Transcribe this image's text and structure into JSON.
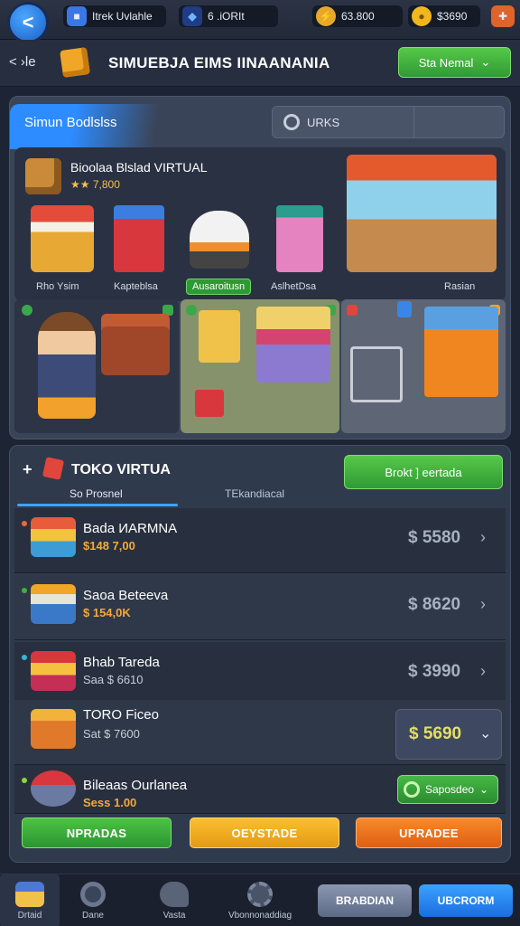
{
  "colors": {
    "accent_blue": "#2d8cff",
    "accent_green": "#3fb13d",
    "accent_orange": "#f0861f",
    "accent_yellow": "#f4b52a",
    "price_highlight": "#e4e060"
  },
  "topbar": {
    "back_label": "<",
    "stat_1": {
      "icon": "game-controller-icon",
      "value": "Itrek Uvlahle"
    },
    "stat_2": {
      "icon": "gem-icon",
      "value": "6 .iORIt"
    },
    "stat_3": {
      "icon": "coin-icon",
      "value": "63.800"
    },
    "stat_4": {
      "icon": "gold-coin-icon",
      "value": "$3690"
    },
    "settings_icon": "tool-icon"
  },
  "header": {
    "back": "< ›le",
    "title": "SIMUEBJA EIMS IINAANANIA",
    "mode_button": "Sta Nemal",
    "mode_chevron": "⌄"
  },
  "panel": {
    "tag": "Simun Bodlslss",
    "search_placeholder": "URKS"
  },
  "business": {
    "title": "Bioolaa Blslad VIRTUAL",
    "stars": "★★",
    "rating_value": "7,800",
    "items": [
      {
        "label": "Rho Ysim"
      },
      {
        "label": "Kapteblsa"
      },
      {
        "label": "Ausaroitusn"
      },
      {
        "label": "AslhetDsa"
      },
      {
        "label": "Rasian"
      }
    ],
    "selected_index": 2
  },
  "section": {
    "plus": "+",
    "name": "TOKO VIRTUA",
    "cta": "Brokt ] eertada",
    "tab_1": "So Prosnel",
    "tab_2": "TEkandiacal"
  },
  "rows": [
    {
      "name": "Bada ИARMNA",
      "sub": "$148 7,00",
      "price": "$ 5580",
      "chev": "›"
    },
    {
      "name": "Saoa Beteeva",
      "sub": "$ 154,0K",
      "price": "$ 8620",
      "chev": "›"
    },
    {
      "name": "Bhab Tareda",
      "sub": "Saa $ 6610",
      "price": "$ 3990",
      "chev": "›"
    },
    {
      "name": "TORO Ficeo",
      "sub": "Sat $ 7600",
      "price": "$ 5690",
      "chev": "⌄"
    },
    {
      "name": "Bileaas Ourlanea",
      "sub": "Sess 1.00",
      "price": "",
      "chev": ""
    }
  ],
  "apply_chip": "Saposdeo",
  "buttons": {
    "green": "NPRADAS",
    "yellow": "OEYSTADE",
    "orange": "UPRADEE"
  },
  "nav": {
    "items": [
      {
        "label": "Drtaid",
        "icon": "shop-icon"
      },
      {
        "label": "Dane",
        "icon": "gear-wheel-icon"
      },
      {
        "label": "Vasta",
        "icon": "heart-icon"
      },
      {
        "label": "Vbonnonaddiag",
        "icon": "cog-icon"
      }
    ],
    "btn_1": "BRABDIAN",
    "btn_2": "UBCRORM"
  }
}
